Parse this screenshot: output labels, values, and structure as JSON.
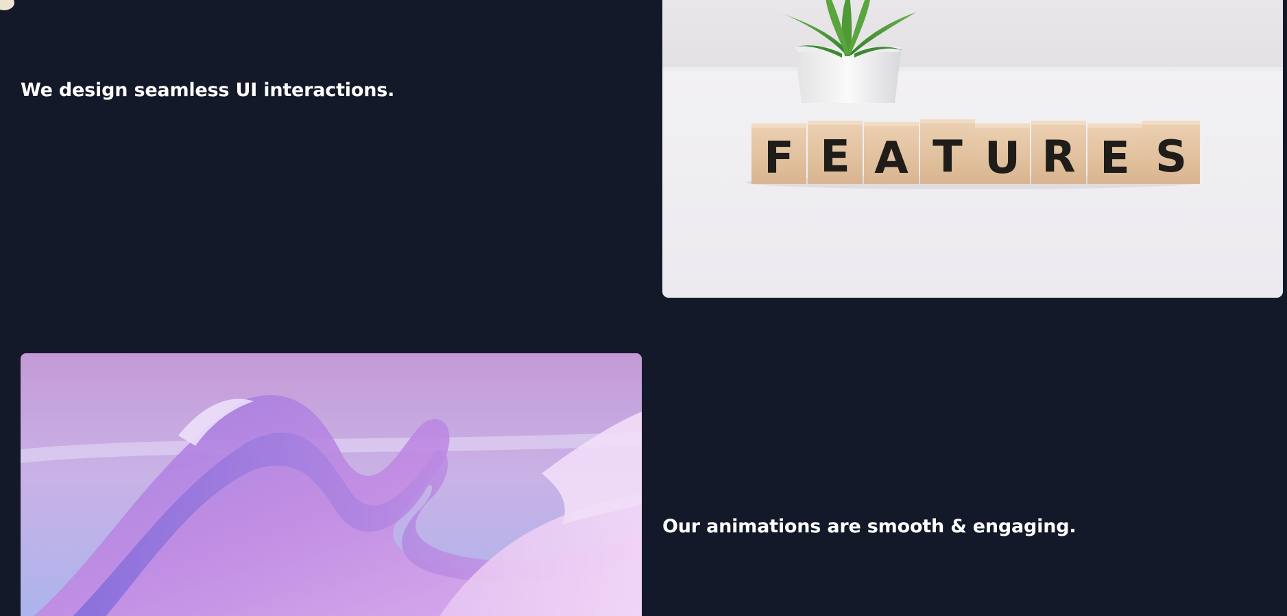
{
  "sections": [
    {
      "headline": "We design seamless UI interactions.",
      "image": {
        "subject": "wooden blocks with a potted succulent",
        "block_letters": [
          "F",
          "E",
          "A",
          "T",
          "U",
          "R",
          "E",
          "S"
        ]
      }
    },
    {
      "headline": "Our animations are smooth & engaging.",
      "image": {
        "subject": "abstract purple flowing ribbons"
      }
    }
  ],
  "colors": {
    "background": "#131929",
    "headline_text": "#ffffff",
    "cursor_dot": "#ece4cf"
  }
}
